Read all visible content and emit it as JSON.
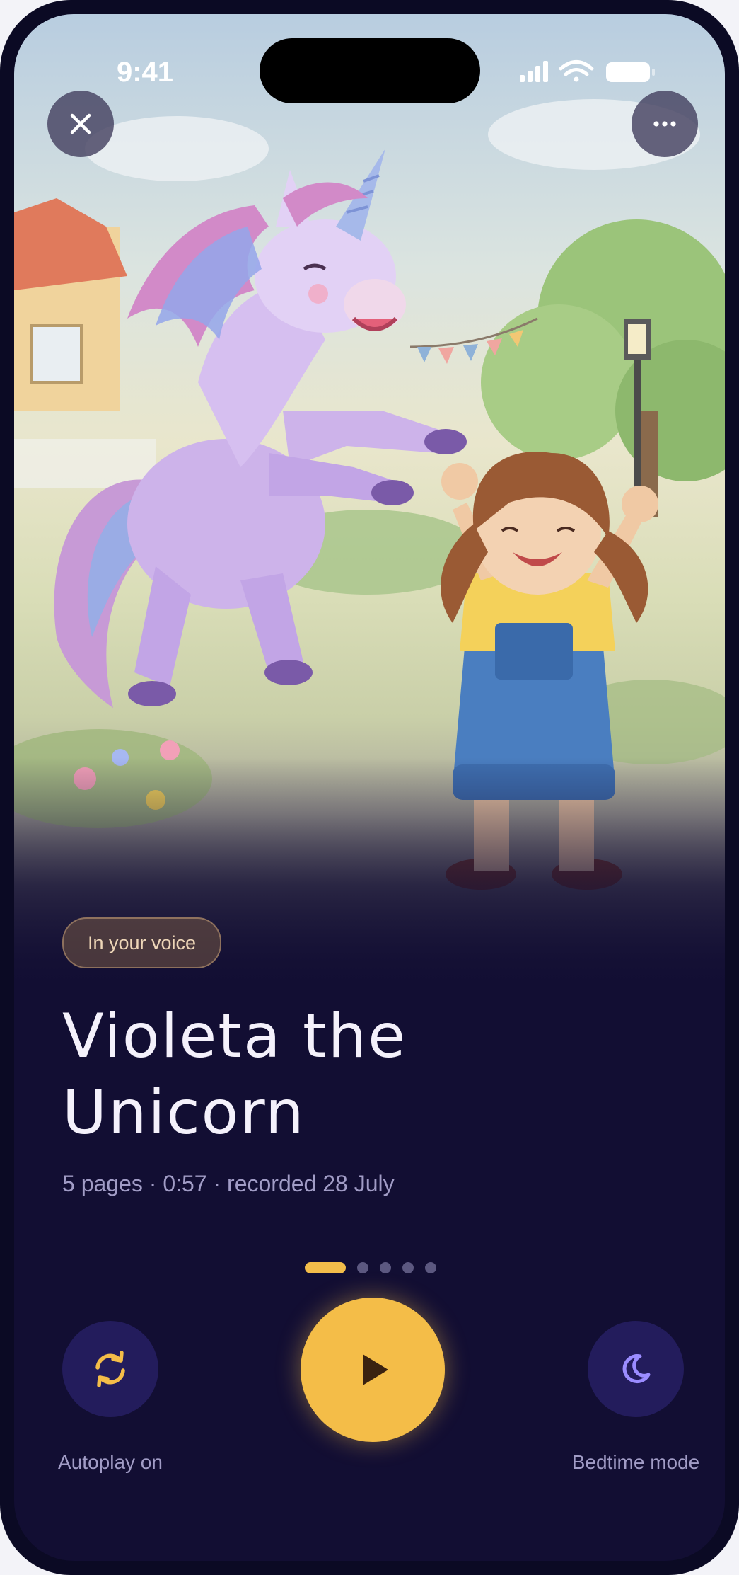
{
  "status_bar": {
    "time": "9:41",
    "icons": [
      "signal-icon",
      "wifi-icon",
      "battery-icon"
    ]
  },
  "top_controls": {
    "close_icon": "close-icon",
    "more_icon": "more-icon"
  },
  "story": {
    "badge": "In your voice",
    "title": "Violeta the Unicorn",
    "meta": "5 pages · 0:57 · recorded 28 July",
    "illustration": "unicorn-and-girl-illustration"
  },
  "pagination": {
    "current_page": 1,
    "total_pages": 5
  },
  "controls": {
    "autoplay_label": "Autoplay on",
    "autoplay_icon": "repeat-icon",
    "play_icon": "play-icon",
    "bedtime_label": "Bedtime mode",
    "bedtime_icon": "moon-icon"
  },
  "colors": {
    "background": "#120e33",
    "accent": "#f4bd48",
    "control_bg": "#231c5c",
    "muted_text": "#a19cc6",
    "moon": "#9b8cff"
  }
}
